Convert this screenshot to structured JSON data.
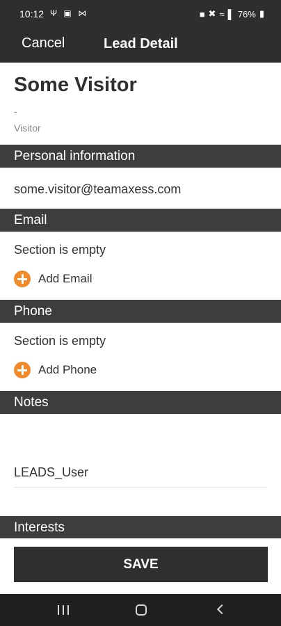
{
  "status_bar": {
    "time": "10:12",
    "left_icons": "Ψ ▣ ⋈",
    "battery": "76%"
  },
  "nav": {
    "cancel_label": "Cancel",
    "title": "Lead Detail"
  },
  "lead": {
    "name": "Some Visitor",
    "subtitle": "-",
    "role": "Visitor"
  },
  "sections": {
    "personal": {
      "title": "Personal information",
      "email_value": "some.visitor@teamaxess.com"
    },
    "email": {
      "title": "Email",
      "empty_text": "Section is empty",
      "add_label": "Add Email"
    },
    "phone": {
      "title": "Phone",
      "empty_text": "Section is empty",
      "add_label": "Add Phone"
    },
    "notes": {
      "title": "Notes",
      "user": "LEADS_User"
    },
    "interests": {
      "title": "Interests"
    }
  },
  "save_label": "SAVE",
  "colors": {
    "dark": "#2e2e2e",
    "section": "#3d3d3d",
    "accent": "#f28a2a"
  },
  "icons": {
    "add": "plus-circle-icon",
    "recents": "recents-icon",
    "home": "home-icon",
    "back": "back-icon"
  }
}
